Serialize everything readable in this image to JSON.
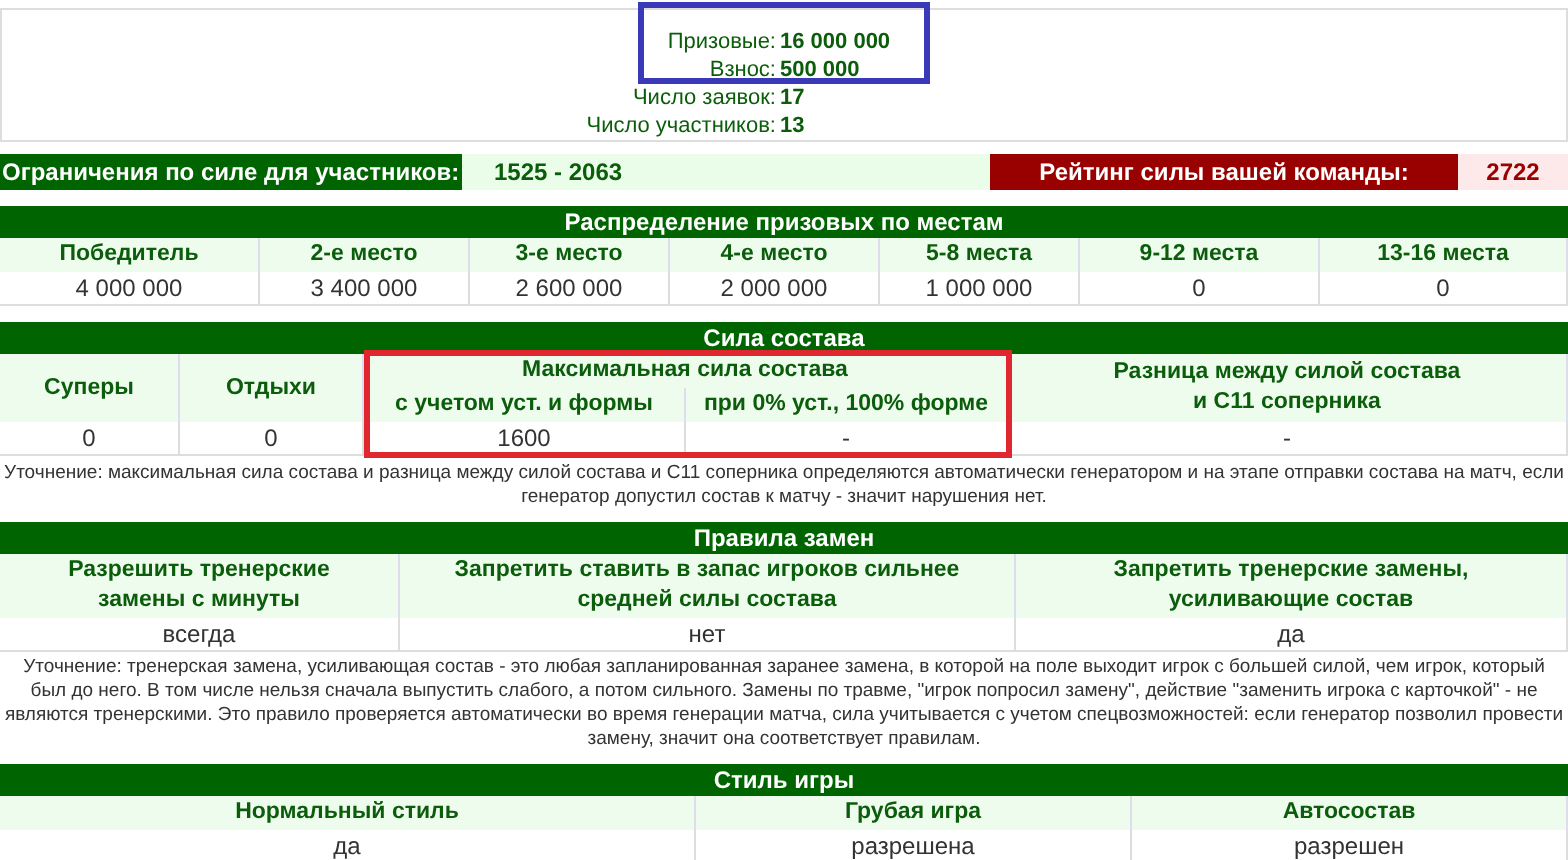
{
  "summary": [
    {
      "label": "Призовые:",
      "value": "16 000 000"
    },
    {
      "label": "Взнос:",
      "value": "500 000"
    },
    {
      "label": "Число заявок:",
      "value": "17"
    },
    {
      "label": "Число участников:",
      "value": "13"
    }
  ],
  "limits": {
    "label": "Ограничения по силе для участников:",
    "value": "1525 - 2063",
    "rating_label": "Рейтинг силы вашей команды:",
    "rating_value": "2722"
  },
  "prize_distribution": {
    "title": "Распределение призовых по местам",
    "columns": [
      "Победитель",
      "2-е место",
      "3-е место",
      "4-е место",
      "5-8 места",
      "9-12 места",
      "13-16 места"
    ],
    "values": [
      "4 000 000",
      "3 400 000",
      "2 600 000",
      "2 000 000",
      "1 000 000",
      "0",
      "0"
    ]
  },
  "squad_strength": {
    "title": "Сила состава",
    "columns": [
      "Суперы",
      "Отдыхи",
      "Максимальная сила состава",
      "Разница между силой состава и С11 соперника"
    ],
    "subcolumns": [
      "с учетом уст. и формы",
      "при 0% уст., 100% форме"
    ],
    "values": [
      "0",
      "0",
      "1600",
      "-",
      "-"
    ],
    "note": "Уточнение: максимальная сила состава и разница между силой состава и С11 соперника определяются автоматически генератором и на этапе отправки состава на матч, если генератор допустил состав к матчу - значит нарушения нет."
  },
  "substitution_rules": {
    "title": "Правила замен",
    "columns": [
      "Разрешить тренерские замены с минуты",
      "Запретить ставить в запас игроков сильнее средней силы состава",
      "Запретить тренерские замены, усиливающие состав"
    ],
    "values": [
      "всегда",
      "нет",
      "да"
    ],
    "note": "Уточнение: тренерская замена, усиливающая состав - это любая запланированная заранее замена, в которой на поле выходит игрок с большей силой, чем игрок, который был до него. В том числе нельзя сначала выпустить слабого, а потом сильного. Замены по травме, \"игрок попросил замену\", действие \"заменить игрока с карточкой\" - не являются тренерскими. Это правило проверяется автоматически во время генерации матча, сила учитывается с учетом спецвозможностей: если генератор позволил провести замену, значит она соответствует правилам."
  },
  "play_style": {
    "title": "Стиль игры",
    "columns": [
      "Нормальный стиль",
      "Грубая игра",
      "Автосостав"
    ],
    "values": [
      "да",
      "разрешена",
      "разрешен"
    ]
  },
  "annotations": [
    {
      "kind": "frame",
      "color": "#3a3ab8"
    },
    {
      "kind": "frame",
      "color": "#e0262e"
    }
  ]
}
